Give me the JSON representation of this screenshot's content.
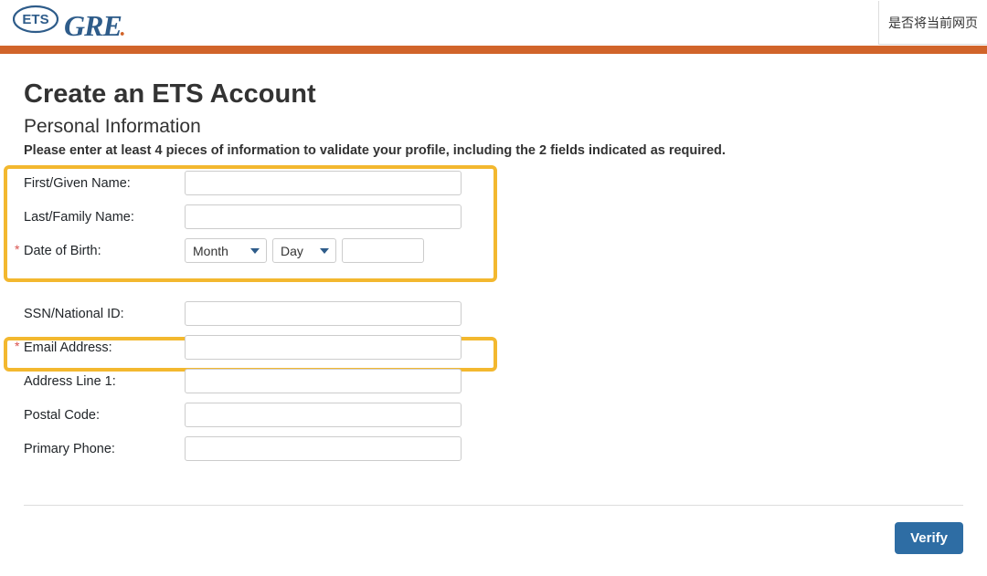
{
  "header": {
    "brand_gre": "GRE",
    "lang_tab_text": "是否将当前网页"
  },
  "page": {
    "title": "Create an ETS Account",
    "subtitle": "Personal Information",
    "instructions": "Please enter at least 4 pieces of information to validate your profile, including the 2 fields indicated as required."
  },
  "form": {
    "first_name_label": "First/Given Name:",
    "last_name_label": "Last/Family Name:",
    "dob_label": "Date of Birth:",
    "month_option": "Month",
    "day_option": "Day",
    "ssn_label": "SSN/National ID:",
    "email_label": "Email Address:",
    "address1_label": "Address Line 1:",
    "postal_label": "Postal Code:",
    "phone_label": "Primary Phone:",
    "required_star": "*"
  },
  "buttons": {
    "verify": "Verify"
  }
}
